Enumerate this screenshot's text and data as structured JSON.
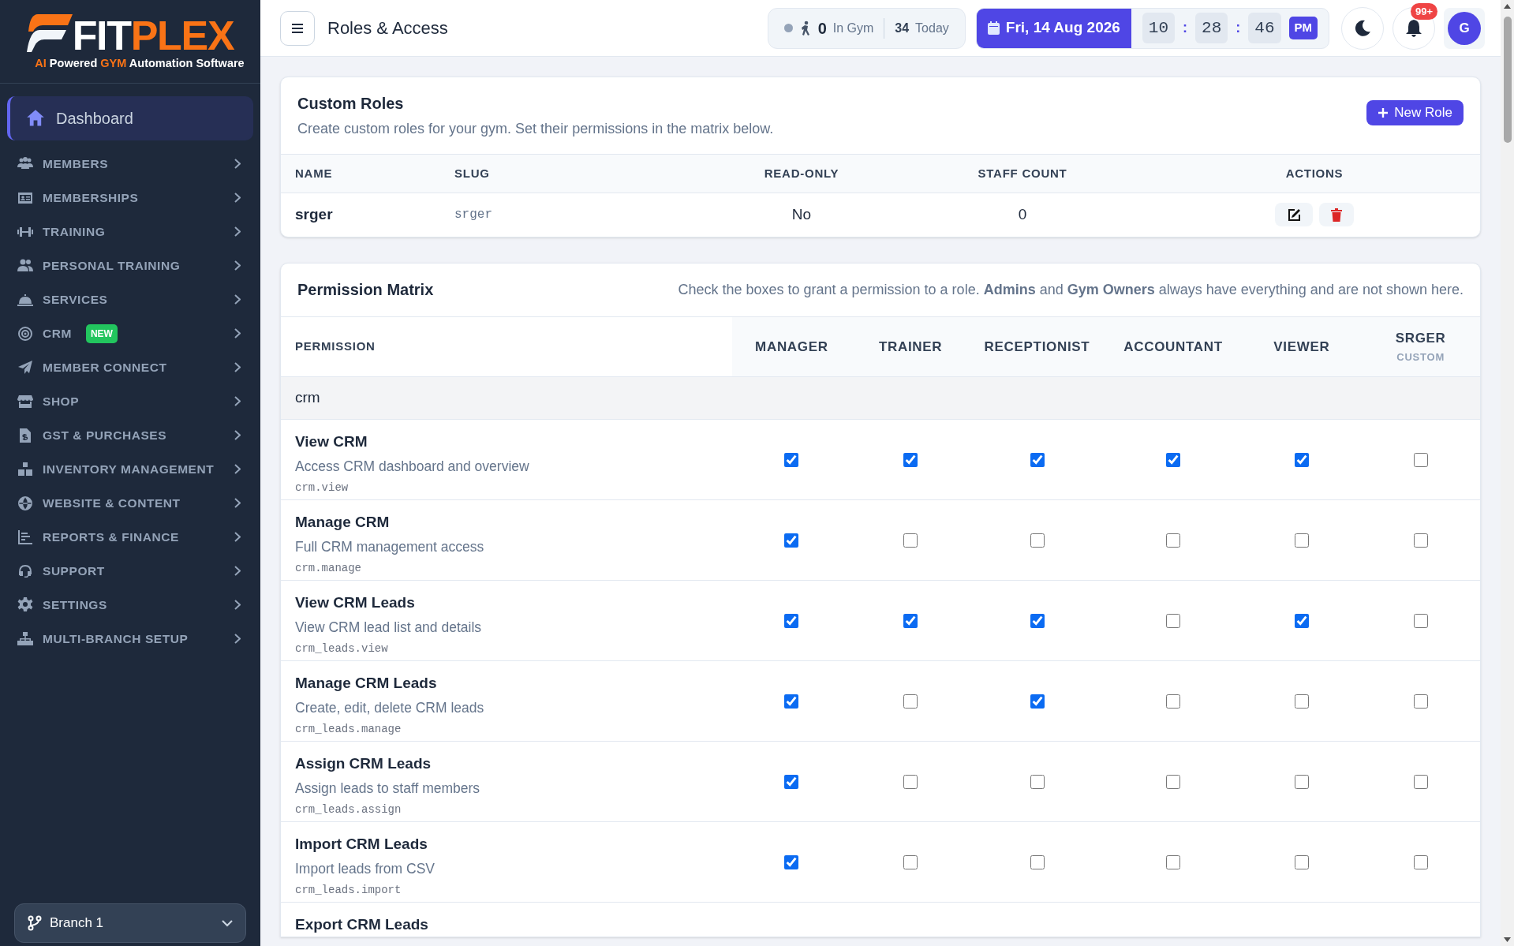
{
  "logo": {
    "word_1": "FIT",
    "word_2": "PLEX",
    "tagline": [
      {
        "text": "AI",
        "accent": true
      },
      {
        "text": " Powered ",
        "accent": false
      },
      {
        "text": "GYM",
        "accent": true
      },
      {
        "text": " Automation Software",
        "accent": false
      }
    ]
  },
  "sidebar": {
    "items": [
      {
        "label": "Dashboard",
        "selected": true
      },
      {
        "label": "MEMBERS",
        "selected": false
      },
      {
        "label": "MEMBERSHIPS",
        "selected": false
      },
      {
        "label": "TRAINING",
        "selected": false
      },
      {
        "label": "PERSONAL TRAINING",
        "selected": false
      },
      {
        "label": "SERVICES",
        "selected": false
      },
      {
        "label": "CRM",
        "selected": false,
        "badge": "NEW"
      },
      {
        "label": "MEMBER CONNECT",
        "selected": false
      },
      {
        "label": "SHOP",
        "selected": false
      },
      {
        "label": "GST & PURCHASES",
        "selected": false
      },
      {
        "label": "INVENTORY MANAGEMENT",
        "selected": false
      },
      {
        "label": "WEBSITE & CONTENT",
        "selected": false
      },
      {
        "label": "REPORTS & FINANCE",
        "selected": false
      },
      {
        "label": "SUPPORT",
        "selected": false
      },
      {
        "label": "SETTINGS",
        "selected": false
      },
      {
        "label": "MULTI-BRANCH SETUP",
        "selected": false
      }
    ],
    "branch": "Branch 1"
  },
  "header": {
    "title": "Roles & Access",
    "in_gym_count": "0",
    "in_gym_label": "In Gym",
    "today_count": "34",
    "today_label": "Today",
    "date": "Fri, 14 Aug 2026",
    "hours": "10",
    "minutes": "28",
    "seconds": "46",
    "separator": ":",
    "meridiem": "PM",
    "notifications": "99+",
    "avatar": "G"
  },
  "custom_roles": {
    "title": "Custom Roles",
    "subtitle": "Create custom roles for your gym. Set their permissions in the matrix below.",
    "new_button": "New Role",
    "columns": [
      "NAME",
      "SLUG",
      "READ-ONLY",
      "STAFF COUNT",
      "ACTIONS"
    ],
    "rows": [
      {
        "name": "srger",
        "slug": "srger",
        "read_only": "No",
        "staff_count": "0"
      }
    ]
  },
  "matrix": {
    "title": "Permission Matrix",
    "hint": "Check the boxes to grant a permission to a role. **Admins** and **Gym Owners** always have everything and are not shown here.",
    "permission_column": "PERMISSION",
    "roles": [
      {
        "name": "MANAGER"
      },
      {
        "name": "TRAINER"
      },
      {
        "name": "RECEPTIONIST"
      },
      {
        "name": "ACCOUNTANT"
      },
      {
        "name": "VIEWER"
      },
      {
        "name": "SRGER",
        "tag": "CUSTOM"
      }
    ],
    "groups": [
      {
        "name": "crm",
        "permissions": [
          {
            "title": "View CRM",
            "description": "Access CRM dashboard and overview",
            "key": "crm.view",
            "checked": [
              true,
              true,
              true,
              true,
              true,
              false
            ]
          },
          {
            "title": "Manage CRM",
            "description": "Full CRM management access",
            "key": "crm.manage",
            "checked": [
              true,
              false,
              false,
              false,
              false,
              false
            ]
          },
          {
            "title": "View CRM Leads",
            "description": "View CRM lead list and details",
            "key": "crm_leads.view",
            "checked": [
              true,
              true,
              true,
              false,
              true,
              false
            ]
          },
          {
            "title": "Manage CRM Leads",
            "description": "Create, edit, delete CRM leads",
            "key": "crm_leads.manage",
            "checked": [
              true,
              false,
              true,
              false,
              false,
              false
            ]
          },
          {
            "title": "Assign CRM Leads",
            "description": "Assign leads to staff members",
            "key": "crm_leads.assign",
            "checked": [
              true,
              false,
              false,
              false,
              false,
              false
            ]
          },
          {
            "title": "Import CRM Leads",
            "description": "Import leads from CSV",
            "key": "crm_leads.import",
            "checked": [
              true,
              false,
              false,
              false,
              false,
              false
            ]
          },
          {
            "title": "Export CRM Leads"
          }
        ]
      }
    ]
  }
}
